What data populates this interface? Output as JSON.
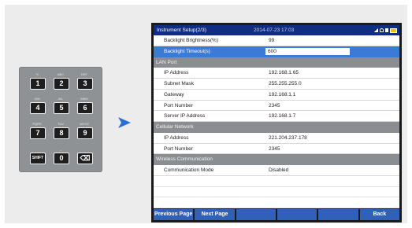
{
  "keypad": {
    "keys": [
      {
        "label": "1",
        "sub": "*!/"
      },
      {
        "label": "2",
        "sub": "ABC"
      },
      {
        "label": "3",
        "sub": "DEF"
      },
      {
        "label": "4",
        "sub": "GHI"
      },
      {
        "label": "5",
        "sub": "JKL"
      },
      {
        "label": "6",
        "sub": "MNO"
      },
      {
        "label": "7",
        "sub": "PQRS"
      },
      {
        "label": "8",
        "sub": "TUV"
      },
      {
        "label": "9",
        "sub": "WXYZ"
      },
      {
        "label": "SHIFT",
        "sub": ""
      },
      {
        "label": "0",
        "sub": "_"
      },
      {
        "label": "⌫",
        "sub": ""
      }
    ]
  },
  "screen": {
    "title": "Instrument Setup(2/3)",
    "datetime": "2014-07-23 17:03",
    "rows": [
      {
        "type": "item",
        "label": "Backlight Brightness(%)",
        "value": "99"
      },
      {
        "type": "active",
        "label": "Backlight Timeout(s)",
        "value": "600"
      },
      {
        "type": "section",
        "label": "LAN Port"
      },
      {
        "type": "item",
        "label": "IP Address",
        "value": "192.168.1.65"
      },
      {
        "type": "item",
        "label": "Subnet Mask",
        "value": "255.255.255.0"
      },
      {
        "type": "item",
        "label": "Gateway",
        "value": "192.168.1.1"
      },
      {
        "type": "item",
        "label": "Port Number",
        "value": "2345"
      },
      {
        "type": "item",
        "label": "Server IP Address",
        "value": "192.168.1.7"
      },
      {
        "type": "section",
        "label": "Cellular Network"
      },
      {
        "type": "item",
        "label": "IP Address",
        "value": "221.204.237.178"
      },
      {
        "type": "item",
        "label": "Port Number",
        "value": "2345"
      },
      {
        "type": "section",
        "label": "Wireless Communication"
      },
      {
        "type": "item",
        "label": "Communication Mode",
        "value": "Disabled"
      },
      {
        "type": "empty"
      },
      {
        "type": "empty"
      },
      {
        "type": "empty"
      }
    ],
    "softkeys": [
      "Previous Page",
      "Next Page",
      "",
      "",
      "",
      "Back"
    ]
  },
  "colors": {
    "titlebar": "#0f2d82",
    "softkey": "#2f61b8",
    "highlight": "#3a7bd5",
    "section": "#8a8e92",
    "arrow": "#2a6fd6"
  }
}
